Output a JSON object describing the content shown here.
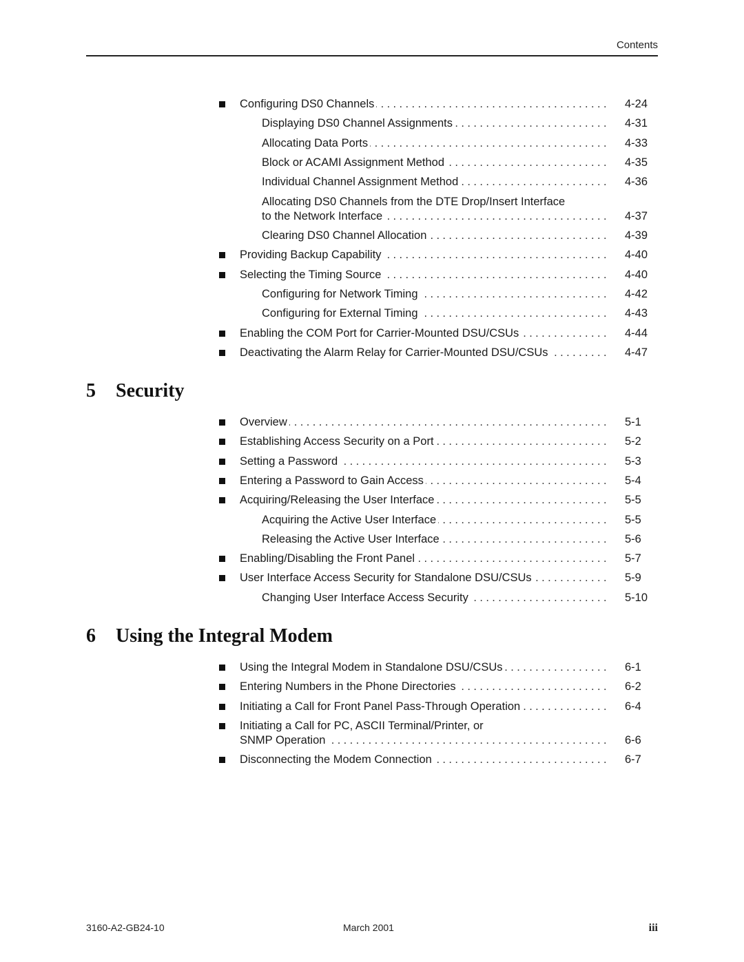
{
  "header": {
    "section_label": "Contents"
  },
  "pre_entries": [
    {
      "level": 1,
      "title": "Configuring DS0 Channels",
      "page": "4-24"
    },
    {
      "level": 2,
      "title": "Displaying DS0 Channel Assignments",
      "page": "4-31"
    },
    {
      "level": 2,
      "title": "Allocating Data Ports",
      "page": "4-33"
    },
    {
      "level": 2,
      "title": "Block or ACAMI Assignment Method",
      "page": "4-35"
    },
    {
      "level": 2,
      "title": "Individual Channel Assignment Method",
      "page": "4-36"
    },
    {
      "level": 2,
      "title_line1": "Allocating DS0 Channels from the DTE Drop/Insert Interface",
      "title": "to the Network Interface",
      "page": "4-37"
    },
    {
      "level": 2,
      "title": "Clearing DS0 Channel Allocation",
      "page": "4-39"
    },
    {
      "level": 1,
      "title": "Providing Backup Capability",
      "page": "4-40"
    },
    {
      "level": 1,
      "title": "Selecting the Timing Source",
      "page": "4-40"
    },
    {
      "level": 2,
      "title": "Configuring for Network Timing",
      "page": "4-42"
    },
    {
      "level": 2,
      "title": "Configuring for External Timing",
      "page": "4-43"
    },
    {
      "level": 1,
      "title": "Enabling the COM Port for Carrier-Mounted DSU/CSUs",
      "page": "4-44"
    },
    {
      "level": 1,
      "title": "Deactivating the Alarm Relay for Carrier-Mounted DSU/CSUs",
      "page": "4-47"
    }
  ],
  "chapters": [
    {
      "number": "5",
      "title": "Security",
      "entries": [
        {
          "level": 1,
          "title": "Overview",
          "page": "5-1"
        },
        {
          "level": 1,
          "title": "Establishing Access Security on a Port",
          "page": "5-2"
        },
        {
          "level": 1,
          "title": "Setting a Password",
          "page": "5-3"
        },
        {
          "level": 1,
          "title": "Entering a Password to Gain Access",
          "page": "5-4"
        },
        {
          "level": 1,
          "title": "Acquiring/Releasing the User Interface",
          "page": "5-5"
        },
        {
          "level": 2,
          "title": "Acquiring the Active User Interface",
          "page": "5-5"
        },
        {
          "level": 2,
          "title": "Releasing the Active User Interface",
          "page": "5-6"
        },
        {
          "level": 1,
          "title": "Enabling/Disabling the Front Panel",
          "page": "5-7"
        },
        {
          "level": 1,
          "title": "User Interface Access Security for Standalone DSU/CSUs",
          "page": "5-9"
        },
        {
          "level": 2,
          "title": "Changing User Interface Access Security",
          "page": "5-10"
        }
      ]
    },
    {
      "number": "6",
      "title": "Using the Integral Modem",
      "entries": [
        {
          "level": 1,
          "title": "Using the Integral Modem in Standalone DSU/CSUs",
          "page": "6-1"
        },
        {
          "level": 1,
          "title": "Entering Numbers in the Phone Directories",
          "page": "6-2"
        },
        {
          "level": 1,
          "title": "Initiating a Call for Front Panel Pass-Through Operation",
          "page": "6-4"
        },
        {
          "level": 1,
          "title_line1": "Initiating a Call for PC, ASCII Terminal/Printer, or",
          "title": "SNMP Operation",
          "page": "6-6"
        },
        {
          "level": 1,
          "title": "Disconnecting the Modem Connection",
          "page": "6-7"
        }
      ]
    }
  ],
  "footer": {
    "document_number": "3160-A2-GB24-10",
    "date": "March 2001",
    "page_number": "iii"
  }
}
